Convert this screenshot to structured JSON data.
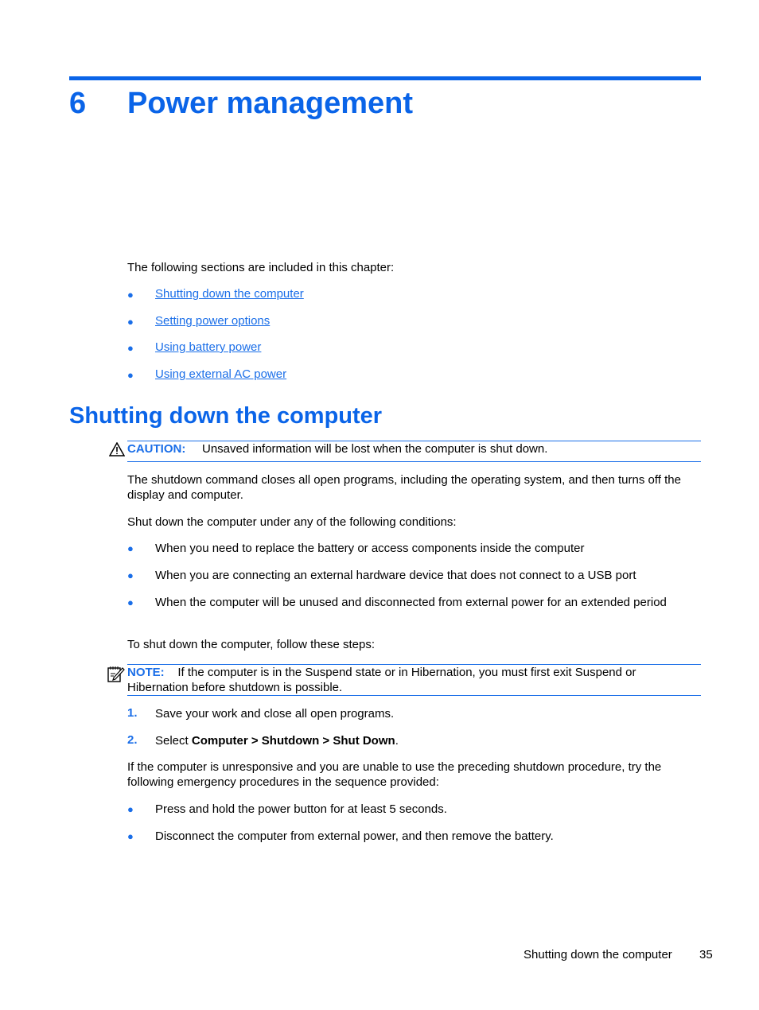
{
  "chapter": {
    "number": "6",
    "title": "Power management"
  },
  "intro": "The following sections are included in this chapter:",
  "toc_links": [
    "Shutting down the computer",
    "Setting power options",
    "Using battery power",
    "Using external AC power"
  ],
  "section": {
    "title": "Shutting down the computer",
    "caution": {
      "label": "CAUTION:",
      "text": "Unsaved information will be lost when the computer is shut down."
    },
    "para1": "The shutdown command closes all open programs, including the operating system, and then turns off the display and computer.",
    "para2": "Shut down the computer under any of the following conditions:",
    "conditions": [
      "When you need to replace the battery or access components inside the computer",
      "When you are connecting an external hardware device that does not connect to a USB port",
      "When the computer will be unused and disconnected from external power for an extended period"
    ],
    "para3": "To shut down the computer, follow these steps:",
    "note": {
      "label": "NOTE:",
      "text": "If the computer is in the Suspend state or in Hibernation, you must first exit Suspend or Hibernation before shutdown is possible."
    },
    "steps": [
      {
        "num": "1.",
        "text": "Save your work and close all open programs."
      },
      {
        "num": "2.",
        "prefix": "Select ",
        "bold": "Computer > Shutdown > Shut Down",
        "suffix": "."
      }
    ],
    "para4": "If the computer is unresponsive and you are unable to use the preceding shutdown procedure, try the following emergency procedures in the sequence provided:",
    "emergency": [
      "Press and hold the power button for at least 5 seconds.",
      "Disconnect the computer from external power, and then remove the battery."
    ]
  },
  "footer": {
    "section": "Shutting down the computer",
    "page": "35"
  }
}
